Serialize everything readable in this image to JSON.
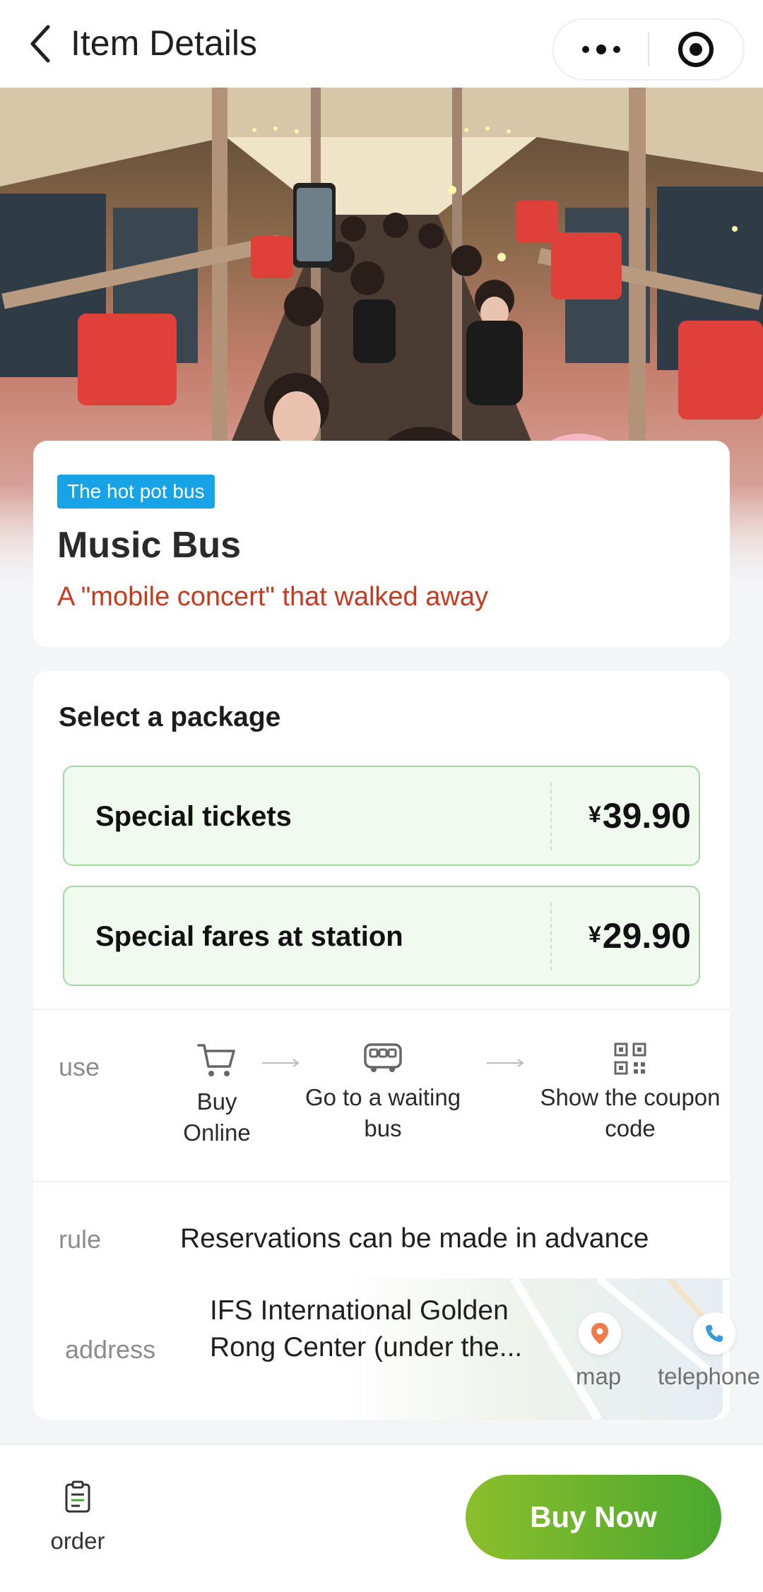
{
  "header": {
    "title": "Item Details",
    "back_icon": "chevron-left-icon",
    "more_icon": "more-dots-icon",
    "close_icon": "target-circle-icon"
  },
  "hero": {
    "image_desc_icon": "photo-icon"
  },
  "item": {
    "tag": "The hot pot bus",
    "title": "Music Bus",
    "subtitle": "A \"mobile concert\" that walked away"
  },
  "packages": {
    "heading": "Select a package",
    "options": [
      {
        "name": "Special tickets",
        "currency": "¥",
        "price": "39.90"
      },
      {
        "name": "Special fares at station",
        "currency": "¥",
        "price": "29.90"
      }
    ]
  },
  "usage": {
    "label": "use",
    "steps": [
      {
        "icon": "cart-icon",
        "label_line1": "Buy",
        "label_line2": "Online"
      },
      {
        "icon": "bus-icon",
        "label_line1": "Go to a waiting",
        "label_line2": "bus"
      },
      {
        "icon": "qr-code-icon",
        "label_line1": "Show the coupon",
        "label_line2": "code"
      }
    ]
  },
  "rule": {
    "label": "rule",
    "text": "Reservations can be made in advance"
  },
  "address": {
    "label": "address",
    "line1": "IFS International Golden",
    "line2": "Rong Center (under the...",
    "map_label": "map",
    "phone_label": "telephone"
  },
  "bottom": {
    "order_label": "order",
    "buy_label": "Buy Now"
  },
  "colors": {
    "accent_green": "#4aa82e",
    "tag_blue": "#17a3e6",
    "subtitle_red": "#c83a1e"
  }
}
